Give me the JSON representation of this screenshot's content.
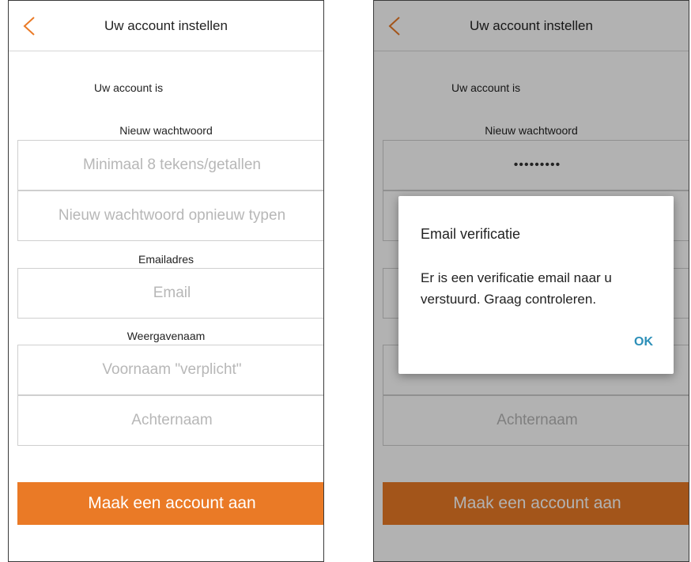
{
  "accent_color": "#ea7a26",
  "screens": {
    "left": {
      "header": {
        "back_icon": "chevron-left-icon",
        "title": "Uw account instellen"
      },
      "account_is": "Uw account is",
      "password_section": {
        "label": "Nieuw wachtwoord",
        "new_placeholder": "Minimaal 8 tekens/getallen",
        "repeat_placeholder": "Nieuw wachtwoord opnieuw typen"
      },
      "email_section": {
        "label": "Emailadres",
        "placeholder": "Email"
      },
      "name_section": {
        "label": "Weergavenaam",
        "first_placeholder": "Voornaam \"verplicht\"",
        "last_placeholder": "Achternaam"
      },
      "submit_label": "Maak een account aan"
    },
    "right": {
      "header": {
        "back_icon": "chevron-left-icon",
        "title": "Uw account instellen"
      },
      "account_is": "Uw account is",
      "password_section": {
        "label": "Nieuw wachtwoord",
        "new_value": "•••••••••"
      },
      "name_section": {
        "last_placeholder": "Achternaam"
      },
      "submit_label": "Maak een account aan",
      "dialog": {
        "title": "Email verificatie",
        "message": "Er is een verificatie email naar u verstuurd. Graag controleren.",
        "ok_label": "OK",
        "button_color": "#2c8fb8"
      }
    }
  }
}
